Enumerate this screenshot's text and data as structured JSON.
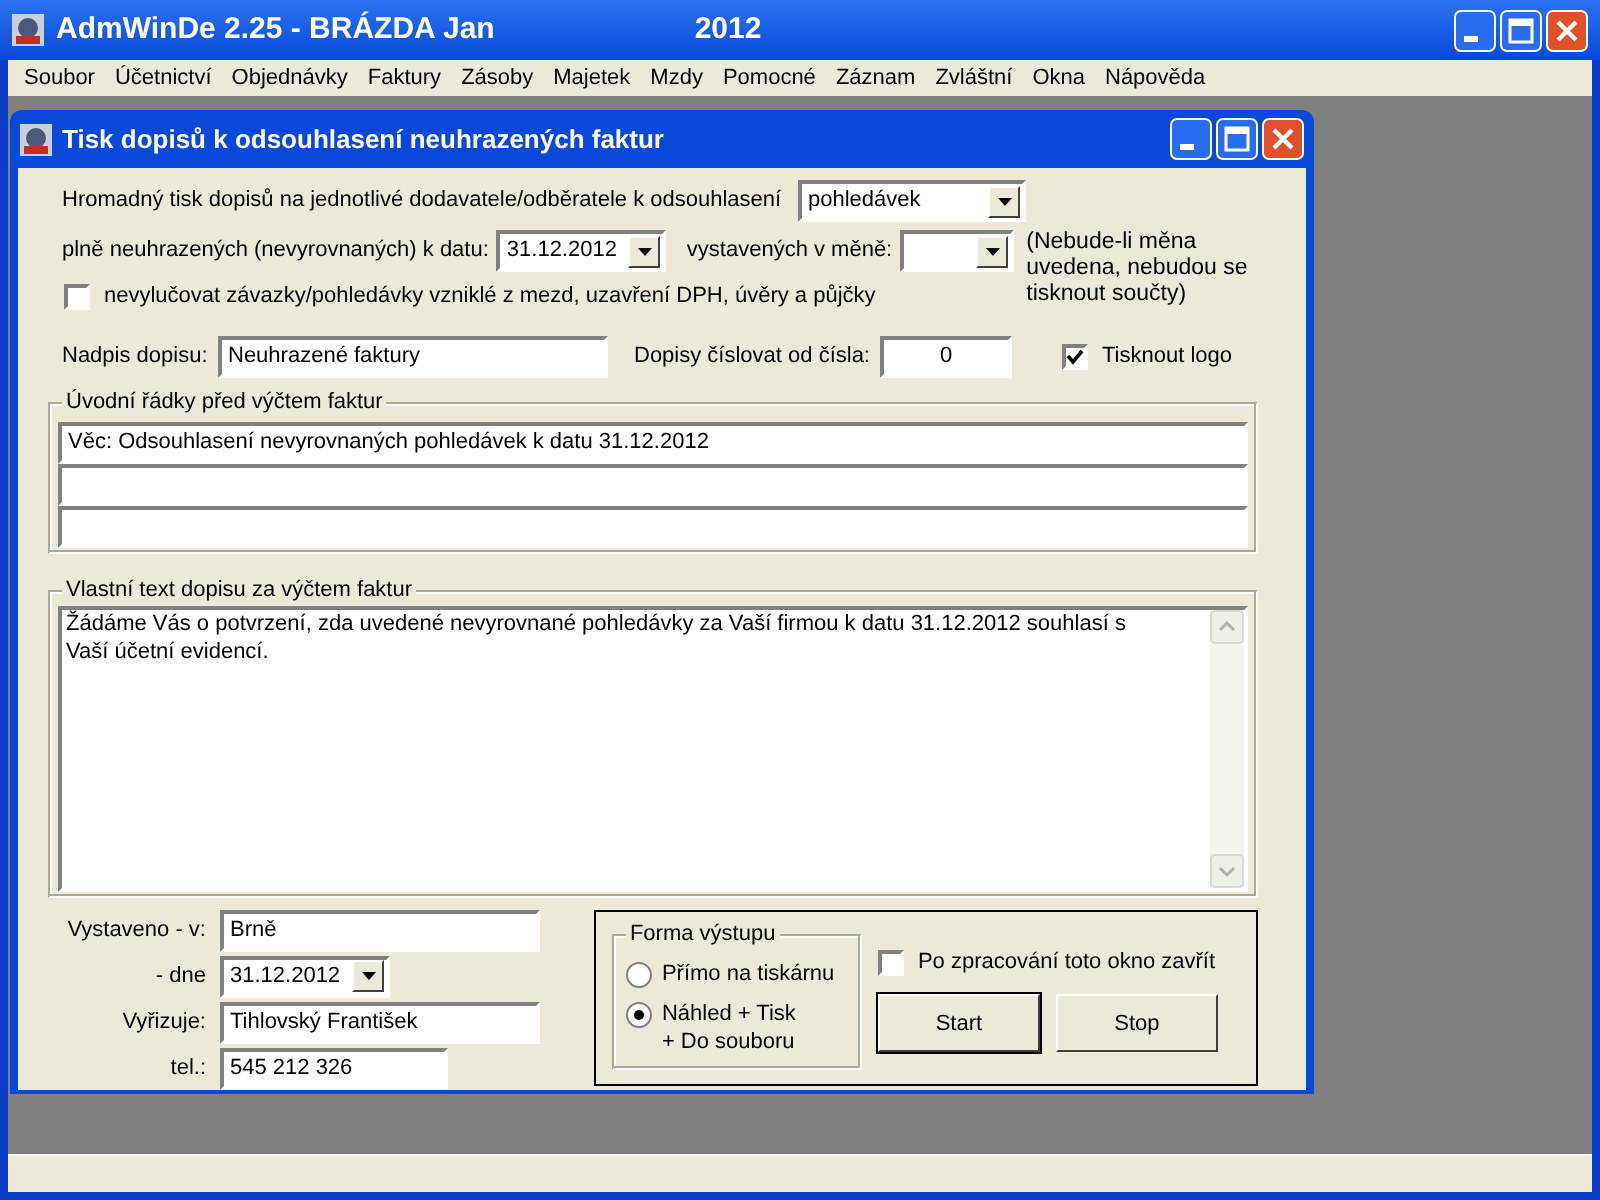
{
  "app_window": {
    "title": "AdmWinDe 2.25 - BRÁZDA Jan",
    "year": "2012"
  },
  "menu": [
    "Soubor",
    "Účetnictví",
    "Objednávky",
    "Faktury",
    "Zásoby",
    "Majetek",
    "Mzdy",
    "Pomocné",
    "Záznam",
    "Zvláštní",
    "Okna",
    "Nápověda"
  ],
  "dialog": {
    "title": "Tisk dopisů k odsouhlasení neuhrazených faktur",
    "mass_print": {
      "label": "Hromadný tisk dopisů na jednotlivé dodavatele/odběratele k odsouhlasení",
      "value": "pohledávek"
    },
    "date": {
      "label": "plně neuhrazených (nevyrovnaných) k datu:",
      "value": "31.12.2012"
    },
    "currency": {
      "label": "vystavených v měně:"
    },
    "currency_note": "(Nebude-li měna uvedena, nebudou se tisknout součty)",
    "exclude": {
      "label": "nevylučovat závazky/pohledávky vzniklé z mezd, uzavření DPH, úvěry a půjčky",
      "checked": false
    },
    "heading": {
      "label": "Nadpis dopisu:",
      "value": "Neuhrazené faktury"
    },
    "numbering": {
      "label": "Dopisy číslovat od čísla:",
      "value": "0"
    },
    "print_logo": {
      "label": "Tisknout logo",
      "checked": true
    },
    "intro": {
      "legend": "Úvodní řádky před výčtem faktur",
      "lines": [
        {
          "kind": "text",
          "value": "Věc: Odsouhlasení nevyrovnaných pohledávek k datu 31.12.2012"
        },
        {
          "kind": "blank"
        },
        {
          "kind": "blank"
        }
      ]
    },
    "body": {
      "legend": "Vlastní text dopisu za výčtem faktur",
      "text": "Žádáme Vás o potvrzení, zda uvedené nevyrovnané pohledávky za Vaší firmou k datu 31.12.2012 souhlasí s Vaší účetní evidencí."
    },
    "issued_place": {
      "label": "Vystaveno - v:",
      "value": "Brně"
    },
    "issued_date": {
      "label": "- dne",
      "value": "31.12.2012"
    },
    "handler": {
      "label": "Vyřizuje:",
      "value": "Tihlovský František"
    },
    "phone": {
      "label": "tel.:",
      "value": "545 212 326"
    },
    "output": {
      "legend": "Forma výstupu",
      "options": [
        {
          "lines": [
            "Přímo na tiskárnu"
          ],
          "selected": false
        },
        {
          "lines": [
            "Náhled + Tisk",
            "+ Do souboru"
          ],
          "selected": true
        }
      ]
    },
    "close_after": {
      "label": "Po zpracování toto okno zavřít",
      "checked": false
    },
    "buttons": [
      "Start",
      "Stop"
    ]
  }
}
